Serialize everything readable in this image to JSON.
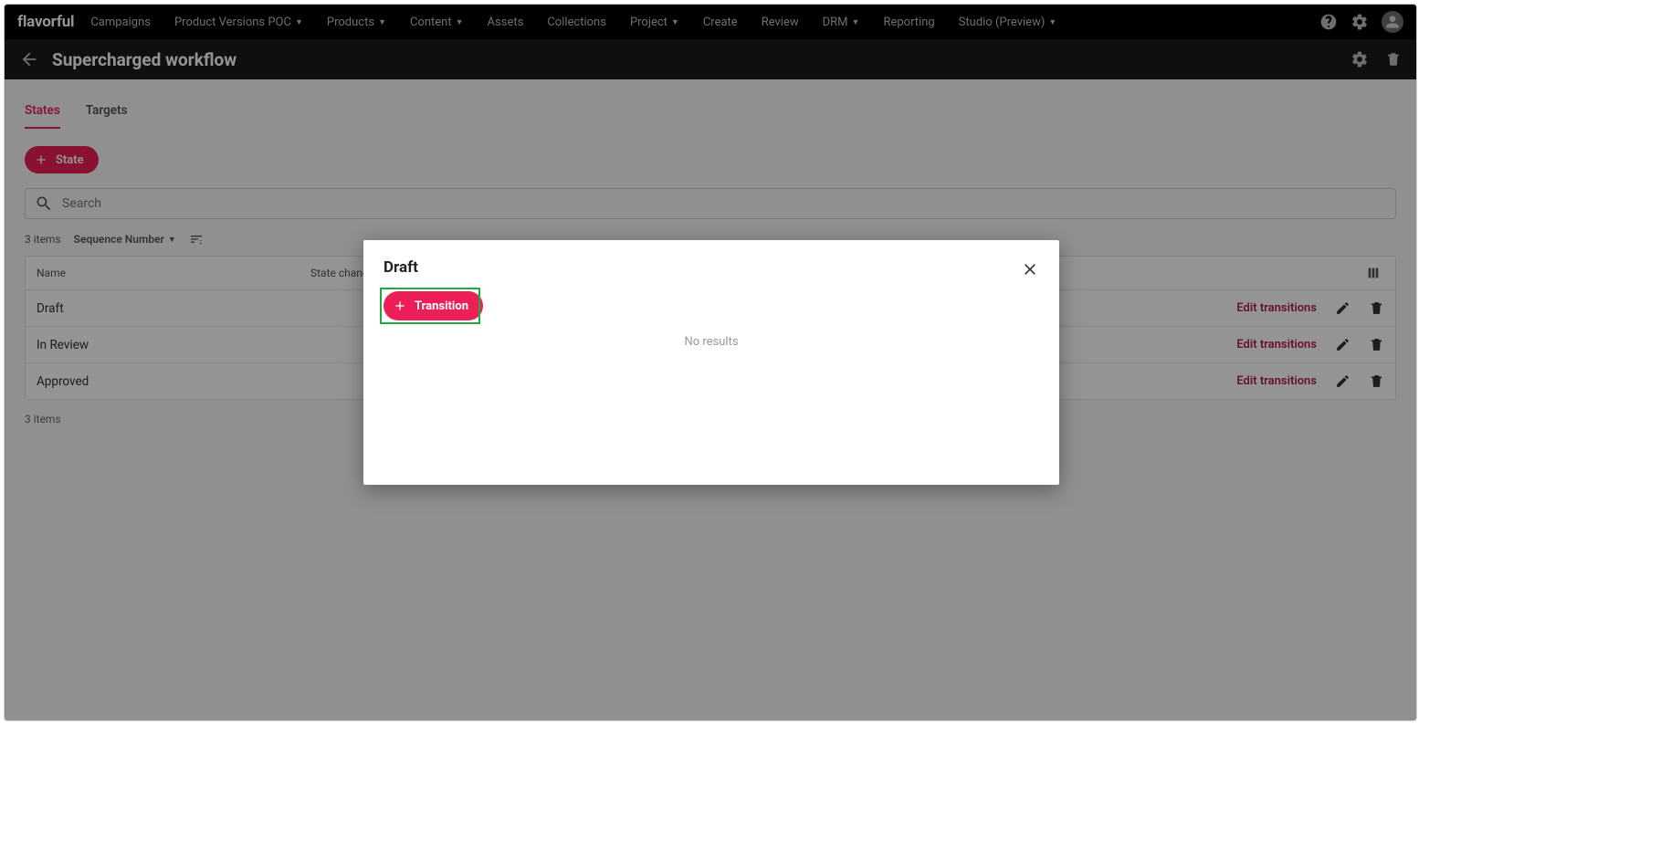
{
  "brand": "flavorful",
  "nav": [
    {
      "label": "Campaigns",
      "dropdown": false
    },
    {
      "label": "Product Versions POC",
      "dropdown": true
    },
    {
      "label": "Products",
      "dropdown": true
    },
    {
      "label": "Content",
      "dropdown": true
    },
    {
      "label": "Assets",
      "dropdown": false
    },
    {
      "label": "Collections",
      "dropdown": false
    },
    {
      "label": "Project",
      "dropdown": true
    },
    {
      "label": "Create",
      "dropdown": false
    },
    {
      "label": "Review",
      "dropdown": false
    },
    {
      "label": "DRM",
      "dropdown": true
    },
    {
      "label": "Reporting",
      "dropdown": false
    },
    {
      "label": "Studio (Preview)",
      "dropdown": true
    }
  ],
  "page_title": "Supercharged workflow",
  "tabs": {
    "states": "States",
    "targets": "Targets"
  },
  "add_state_label": "State",
  "search_placeholder": "Search",
  "items_count_top": "3 items",
  "sort_label": "Sequence Number",
  "columns": {
    "name": "Name",
    "state_changes": "State changes"
  },
  "rows": [
    {
      "name": "Draft",
      "edit": "Edit transitions"
    },
    {
      "name": "In Review",
      "edit": "Edit transitions"
    },
    {
      "name": "Approved",
      "edit": "Edit transitions"
    }
  ],
  "items_count_bottom": "3 items",
  "modal": {
    "title": "Draft",
    "transition_label": "Transition",
    "no_results": "No results"
  }
}
